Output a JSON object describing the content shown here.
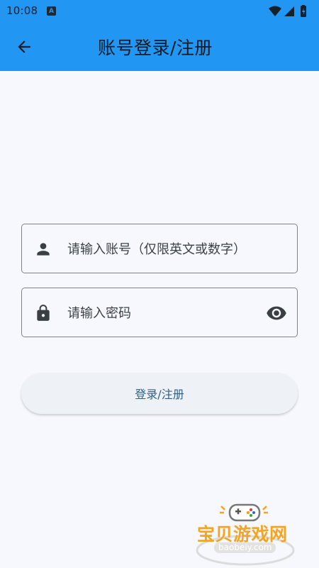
{
  "status_bar": {
    "time": "10:08",
    "notification_letter": "A"
  },
  "app_bar": {
    "title": "账号登录/注册",
    "back_icon": "arrow-left-icon"
  },
  "form": {
    "account": {
      "placeholder": "请输入账号（仅限英文或数字）",
      "value": "",
      "icon": "person-icon"
    },
    "password": {
      "placeholder": "请输入密码",
      "value": "",
      "icon": "lock-icon",
      "toggle_icon": "eye-icon"
    },
    "submit_label": "登录/注册"
  },
  "watermark": {
    "title": "宝贝游戏网",
    "url": "baobeiy.com"
  },
  "colors": {
    "app_bar": "#2196f3",
    "background": "#f6f8fd",
    "button_text": "#2f5f86",
    "watermark": "#f3a421"
  }
}
